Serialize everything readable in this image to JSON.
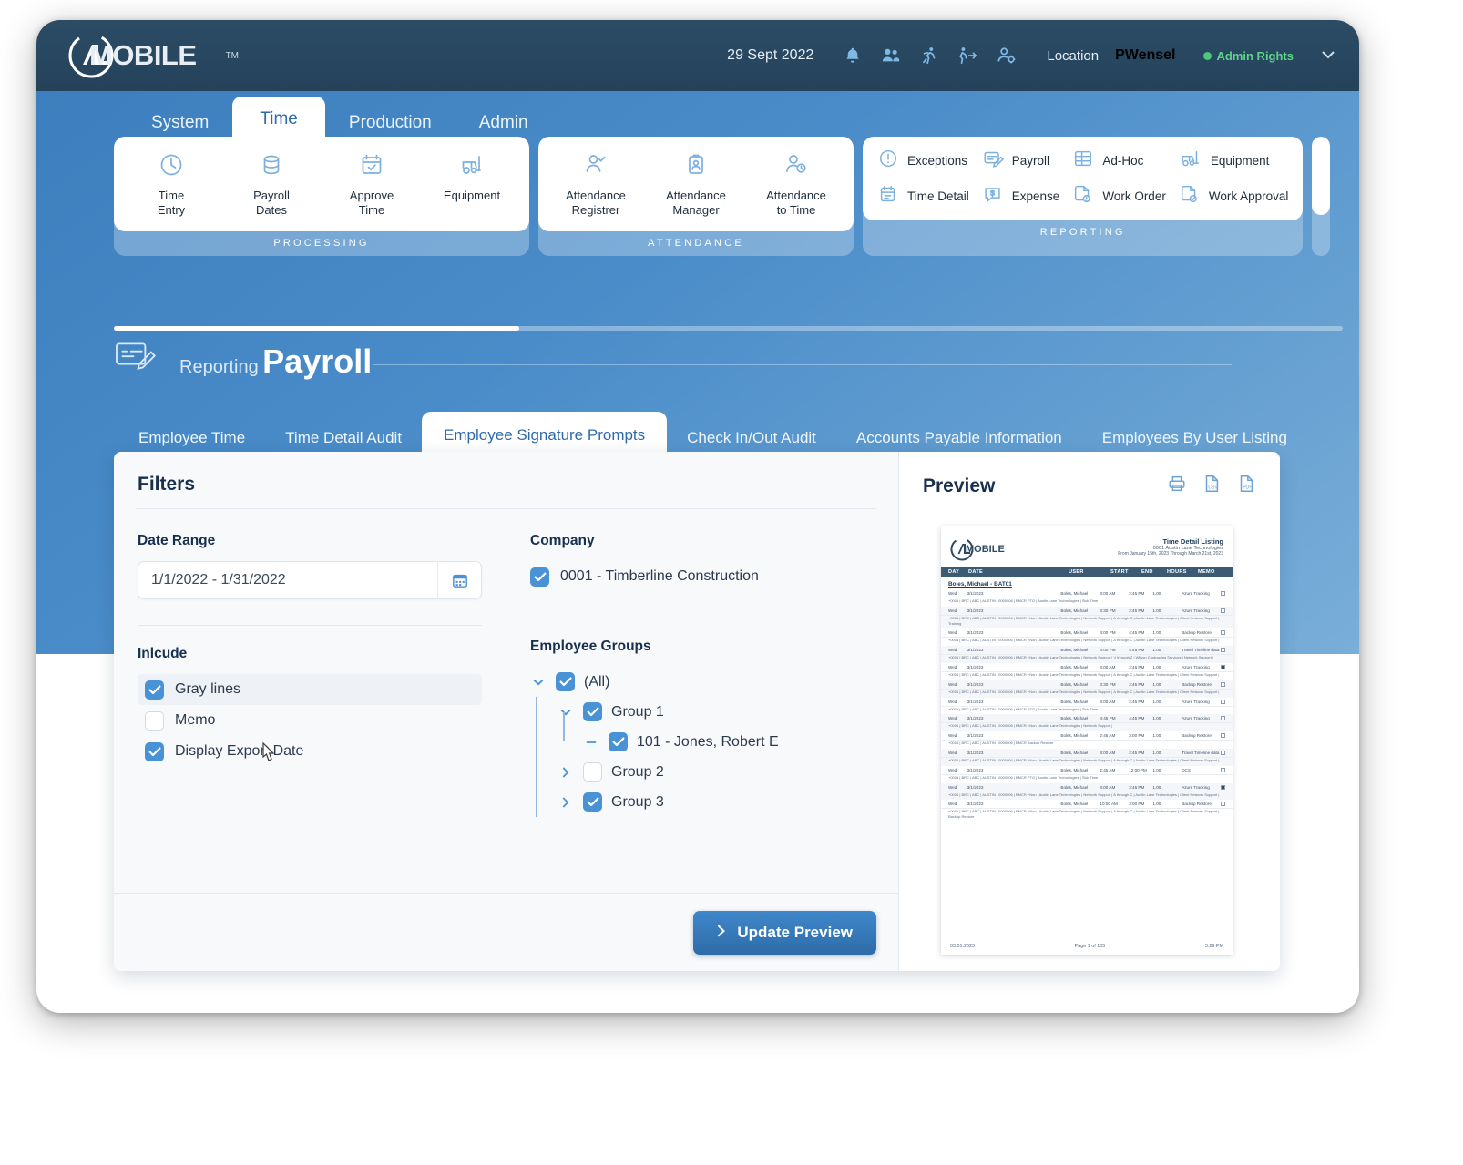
{
  "header": {
    "logo_text": "MOBILE",
    "logo_tm": "TM",
    "date": "29 Sept 2022",
    "icons": [
      "bell-icon",
      "users-icon",
      "running-person-icon",
      "walking-person-arrow-icon",
      "user-settings-icon"
    ],
    "location_label": "Location",
    "location_value": "PWensel",
    "admin_badge": "Admin Rights"
  },
  "nav": {
    "tabs": [
      {
        "label": "System",
        "active": false
      },
      {
        "label": "Time",
        "active": true
      },
      {
        "label": "Production",
        "active": false
      },
      {
        "label": "Admin",
        "active": false
      }
    ]
  },
  "ribbon": {
    "groups": [
      {
        "label": "PROCESSING",
        "layout": "columns",
        "items": [
          {
            "label": "Time\nEntry",
            "icon": "clock-icon"
          },
          {
            "label": "Payroll\nDates",
            "icon": "database-icon"
          },
          {
            "label": "Approve\nTime",
            "icon": "calendar-check-icon"
          },
          {
            "label": "Equipment",
            "icon": "forklift-icon"
          }
        ]
      },
      {
        "label": "ATTENDANCE",
        "layout": "columns",
        "items": [
          {
            "label": "Attendance\nRegistrer",
            "icon": "person-check-icon"
          },
          {
            "label": "Attendance\nManager",
            "icon": "id-badge-icon"
          },
          {
            "label": "Attendance\nto Time",
            "icon": "person-clock-icon"
          }
        ]
      },
      {
        "label": "REPORTING",
        "layout": "grid",
        "items": [
          {
            "label": "Exceptions",
            "icon": "exclamation-circle-icon"
          },
          {
            "label": "Payroll",
            "icon": "check-edit-icon"
          },
          {
            "label": "Ad-Hoc",
            "icon": "table-icon"
          },
          {
            "label": "Equipment",
            "icon": "forklift-icon"
          },
          {
            "label": "Time Detail",
            "icon": "calendar-lines-icon"
          },
          {
            "label": "Expense",
            "icon": "dollar-chat-icon"
          },
          {
            "label": "Work Order",
            "icon": "doc-info-icon"
          },
          {
            "label": "Work Approval",
            "icon": "doc-check-icon"
          }
        ]
      }
    ]
  },
  "page": {
    "kicker": "Reporting",
    "title": "Payroll",
    "icon": "check-edit-icon"
  },
  "report_tabs": [
    {
      "label": "Employee Time",
      "active": false
    },
    {
      "label": "Time Detail Audit",
      "active": false
    },
    {
      "label": "Employee Signature Prompts",
      "active": true
    },
    {
      "label": "Check In/Out Audit",
      "active": false
    },
    {
      "label": "Accounts Payable Information",
      "active": false
    },
    {
      "label": "Employees By User Listing",
      "active": false
    }
  ],
  "filters": {
    "title": "Filters",
    "date_range": {
      "label": "Date Range",
      "value": "1/1/2022 - 1/31/2022",
      "placeholder": "Select date range",
      "icon": "calendar-icon"
    },
    "include": {
      "label": "Inlcude",
      "options": [
        {
          "label": "Gray lines",
          "checked": true,
          "highlighted": true
        },
        {
          "label": "Memo",
          "checked": false,
          "highlighted": false
        },
        {
          "label": "Display Export Date",
          "checked": true,
          "highlighted": false
        }
      ]
    },
    "company": {
      "label": "Company",
      "options": [
        {
          "label": "0001 - Timberline Construction",
          "checked": true
        }
      ]
    },
    "employee_groups": {
      "label": "Employee Groups",
      "nodes": [
        {
          "label": "(All)",
          "checked": true,
          "depth": 0,
          "twisty": "chevron-down-icon"
        },
        {
          "label": "Group 1",
          "checked": true,
          "depth": 1,
          "twisty": "chevron-down-icon"
        },
        {
          "label": "101 - Jones, Robert E",
          "checked": true,
          "depth": 2,
          "twisty": "dash-icon"
        },
        {
          "label": "Group 2",
          "checked": false,
          "depth": 1,
          "twisty": "chevron-right-icon"
        },
        {
          "label": "Group 3",
          "checked": true,
          "depth": 1,
          "twisty": "chevron-right-icon"
        }
      ]
    }
  },
  "preview": {
    "title": "Preview",
    "actions": [
      {
        "name": "print-icon",
        "label": "Print"
      },
      {
        "name": "csv-icon",
        "label": "CSV"
      },
      {
        "name": "pdf-icon",
        "label": "PDF"
      }
    ],
    "document": {
      "logo_text": "MOBILE",
      "report_title": "Time Detail Listing",
      "company": "0001 Austin Lane Technologies",
      "date_range": "From January 15th, 2023  Through March 21st, 2023",
      "columns": [
        "DAY",
        "DATE",
        "USER",
        "START",
        "END",
        "HOURS",
        "MEMO"
      ],
      "employee": "Boles, Michael - BAT01",
      "rows": [
        {
          "day": "Wed",
          "date": "3/1/2023",
          "user": "Boles, Michael",
          "start": "8:00 AM",
          "end": "2:45 PM",
          "hours": "1.00",
          "memo": "Azure Tracking",
          "checked": false,
          "alt": false,
          "sub": "+0001 | BRC | ABC | AUSTIN | 0000006 | BMCR\nPTO | Austin Lane Technologies | Sick Time"
        },
        {
          "day": "Wed",
          "date": "3/1/2023",
          "user": "Boles, Michael",
          "start": "3:30 PM",
          "end": "2:45 PM",
          "hours": "1.00",
          "memo": "Azure Tracking",
          "checked": false,
          "alt": true,
          "sub": "+0001 | BRC | ABC | AUSTIN | 0000006 | BMCR\n+Non | Austin Lane Technologies | Network Support | A through C | Austin Lane Technologies | Client Network Support | Training"
        },
        {
          "day": "Wed",
          "date": "3/1/2023",
          "user": "Boles, Michael",
          "start": "4:00 PM",
          "end": "4:45 PM",
          "hours": "1.00",
          "memo": "Backup Restore",
          "checked": false,
          "alt": false,
          "sub": "+0001 | BRC | ABC | AUSTIN | 0000006 | BMCR\n+Non | Austin Lane Technologies | Network Support | A through C | Austin Lane Technologies | Client Network Support |"
        },
        {
          "day": "Wed",
          "date": "3/1/2023",
          "user": "Boles, Michael",
          "start": "4:00 PM",
          "end": "4:45 PM",
          "hours": "1.00",
          "memo": "Travel Timeline data Resolved multiple user's printer issues",
          "checked": false,
          "alt": true,
          "sub": "+0001 | BRC | ABC | AUSTIN | 0000006 | BMCR\n+Non | Austin Lane Technologies | Network Support | V through Z | Wilson Contracting Services | Network Support |"
        },
        {
          "day": "Wed",
          "date": "3/1/2023",
          "user": "Boles, Michael",
          "start": "8:00 AM",
          "end": "2:45 PM",
          "hours": "1.00",
          "memo": "Azure Tracking",
          "checked": true,
          "alt": false,
          "sub": "+0001 | BRC | ABC | AUSTIN | 0000006 | BMCR\n+Non | Austin Lane Technologies | Network Support | A through C | Austin Lane Technologies | Client Network Support |"
        },
        {
          "day": "Wed",
          "date": "3/1/2023",
          "user": "Boles, Michael",
          "start": "3:30 PM",
          "end": "2:45 PM",
          "hours": "1.00",
          "memo": "Backup Restore",
          "checked": false,
          "alt": true,
          "sub": "+0001 | BRC | ABC | AUSTIN | 0000006 | BMCR\n+Non | Austin Lane Technologies | Network Support | A through C | Austin Lane Technologies | Client Network Support |"
        },
        {
          "day": "Wed",
          "date": "3/1/2023",
          "user": "Boles, Michael",
          "start": "8:00 AM",
          "end": "2:45 PM",
          "hours": "1.00",
          "memo": "Azure Tracking",
          "checked": false,
          "alt": false,
          "sub": "+0001 | BRC | ABC | AUSTIN | 0000006 | BMCR\nPTO | Austin Lane Technologies | Sick Time"
        },
        {
          "day": "Wed",
          "date": "3/1/2023",
          "user": "Boles, Michael",
          "start": "4:45 PM",
          "end": "4:45 PM",
          "hours": "1.00",
          "memo": "Azure Tracking",
          "checked": false,
          "alt": true,
          "sub": "+0001 | BRC | ABC | AUSTIN | 0000006 | BMCR\n+Non | Austin Lane Technologies | Network Support |"
        },
        {
          "day": "Wed",
          "date": "3/1/2023",
          "user": "Boles, Michael",
          "start": "2:45 AM",
          "end": "3:00 PM",
          "hours": "1.00",
          "memo": "Backup Restore",
          "checked": false,
          "alt": false,
          "sub": "+0001 | BRC | ABC | AUSTIN | 0000006 | BMCR\nBackup Restore"
        },
        {
          "day": "Wed",
          "date": "3/1/2023",
          "user": "Boles, Michael",
          "start": "8:00 AM",
          "end": "2:45 PM",
          "hours": "1.00",
          "memo": "Travel Timeline data Resolved multiple user's printer issues",
          "checked": false,
          "alt": true,
          "sub": "+0001 | BRC | ABC | AUSTIN | 0000006 | BMCR\n+Non | Austin Lane Technologies | Network Support | A through C | Austin Lane Technologies | Client Network Support |"
        },
        {
          "day": "Wed",
          "date": "3/1/2023",
          "user": "Boles, Michael",
          "start": "2:45 AM",
          "end": "12:00 PM",
          "hours": "1.00",
          "memo": "DCS",
          "checked": false,
          "alt": false,
          "sub": "+0001 | BRC | ABC | AUSTIN | 0000006 | BMCR\nPTO | Austin Lane Technologies | Sick Time"
        },
        {
          "day": "Wed",
          "date": "3/1/2023",
          "user": "Boles, Michael",
          "start": "8:00 AM",
          "end": "2:45 PM",
          "hours": "1.00",
          "memo": "Azure Tracking",
          "checked": true,
          "alt": true,
          "sub": "+0001 | BRC | ABC | AUSTIN | 0000006 | BMCR\n+Non | Austin Lane Technologies | Network Support | A through C | Austin Lane Technologies | Client Network Support |"
        },
        {
          "day": "Wed",
          "date": "3/1/2023",
          "user": "Boles, Michael",
          "start": "10:00 AM",
          "end": "3:00 PM",
          "hours": "1.00",
          "memo": "Backup Restore",
          "checked": false,
          "alt": false,
          "sub": "+0001 | BRC | ABC | AUSTIN | 0000006 | BMCR\n+Non | Austin Lane Technologies | Network Support | A through C | Austin Lane Technologies | Client Network Support |\nBackup Restore"
        }
      ],
      "footer_date": "03.01.2023",
      "footer_page": "Page 1 of 105",
      "footer_time": "3:29 PM"
    }
  },
  "actions": {
    "update_preview": "Update Preview",
    "update_preview_icon": "chevron-right-icon"
  },
  "colors": {
    "accent": "#3f87cb",
    "header_bg": "#24425a",
    "body_blue": "#4a8cc9",
    "check_blue": "#4a92d6",
    "admin_green": "#4dc878",
    "title_navy": "#17304d"
  }
}
